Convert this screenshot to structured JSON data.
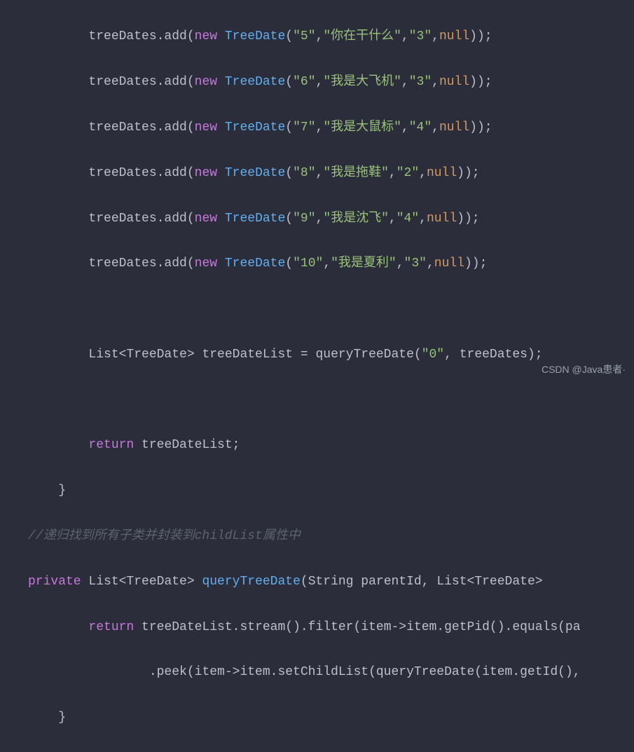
{
  "lines": {
    "l1": {
      "prefix": "        treeDates.add(",
      "new": "new",
      "sp": " ",
      "type": "TreeDate",
      "open": "(",
      "s1": "\"5\"",
      "c1": ",",
      "s2": "\"你在干什么\"",
      "c2": ",",
      "s3": "\"3\"",
      "c3": ",",
      "null": "null",
      "close": "));"
    },
    "l2": {
      "prefix": "        treeDates.add(",
      "new": "new",
      "sp": " ",
      "type": "TreeDate",
      "open": "(",
      "s1": "\"6\"",
      "c1": ",",
      "s2": "\"我是大飞机\"",
      "c2": ",",
      "s3": "\"3\"",
      "c3": ",",
      "null": "null",
      "close": "));"
    },
    "l3": {
      "prefix": "        treeDates.add(",
      "new": "new",
      "sp": " ",
      "type": "TreeDate",
      "open": "(",
      "s1": "\"7\"",
      "c1": ",",
      "s2": "\"我是大鼠标\"",
      "c2": ",",
      "s3": "\"4\"",
      "c3": ",",
      "null": "null",
      "close": "));"
    },
    "l4": {
      "prefix": "        treeDates.add(",
      "new": "new",
      "sp": " ",
      "type": "TreeDate",
      "open": "(",
      "s1": "\"8\"",
      "c1": ",",
      "s2": "\"我是拖鞋\"",
      "c2": ",",
      "s3": "\"2\"",
      "c3": ",",
      "null": "null",
      "close": "));"
    },
    "l5": {
      "prefix": "        treeDates.add(",
      "new": "new",
      "sp": " ",
      "type": "TreeDate",
      "open": "(",
      "s1": "\"9\"",
      "c1": ",",
      "s2": "\"我是沈飞\"",
      "c2": ",",
      "s3": "\"4\"",
      "c3": ",",
      "null": "null",
      "close": "));"
    },
    "l6": {
      "prefix": "        treeDates.add(",
      "new": "new",
      "sp": " ",
      "type": "TreeDate",
      "open": "(",
      "s1": "\"10\"",
      "c1": ",",
      "s2": "\"我是夏利\"",
      "c2": ",",
      "s3": "\"3\"",
      "c3": ",",
      "null": "null",
      "close": "));"
    },
    "l7": {
      "text": " "
    },
    "l8": {
      "prefix": "        List<TreeDate> treeDateList = queryTreeDate(",
      "s1": "\"0\"",
      "suffix": ", treeDates);"
    },
    "l9": {
      "text": " "
    },
    "l10": {
      "indent": "        ",
      "return": "return",
      "rest": " treeDateList;"
    },
    "l11": {
      "text": "    }"
    },
    "l12": {
      "text": "//递归找到所有子类并封装到childList属性中"
    },
    "l13": {
      "private": "private",
      "sig1": " List<TreeDate> ",
      "method": "queryTreeDate",
      "sig2": "(String parentId, List<TreeDate> "
    },
    "l14": {
      "indent": "        ",
      "return": "return",
      "rest": " treeDateList.stream().filter(item->item.getPid().equals(pa"
    },
    "l15": {
      "text": "                .peek(item->item.setChildList(queryTreeDate(item.getId(),"
    },
    "l16": {
      "text": "    }"
    }
  },
  "watermark": "CSDN @Java患者·"
}
